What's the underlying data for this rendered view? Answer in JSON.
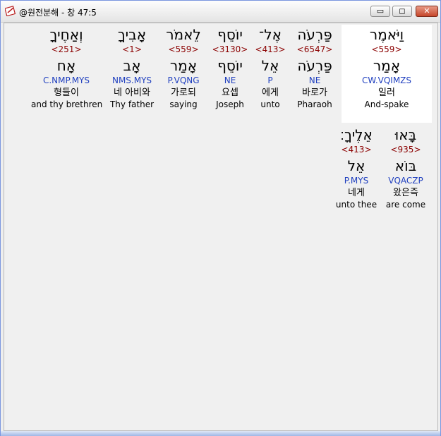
{
  "window": {
    "title": "@원전분해 - 창 47:5",
    "min_glyph": "▭",
    "max_glyph": "◻",
    "close_glyph": "✕"
  },
  "words": [
    {
      "hebrew": "וַיֹּאמֶר",
      "strong": "<559>",
      "lemma": "אָמַר",
      "morph": "CW.VQIMZS",
      "korean": "일러",
      "english": "And-spake",
      "highlighted": true
    },
    {
      "hebrew": "פַּרְעֹה",
      "strong": "<6547>",
      "lemma": "פַּרְעֹה",
      "morph": "NE",
      "korean": "바로가",
      "english": "Pharaoh",
      "highlighted": false
    },
    {
      "hebrew": "אֶל־",
      "strong": "<413>",
      "lemma": "אֵל",
      "morph": "P",
      "korean": "에게",
      "english": "unto",
      "highlighted": false
    },
    {
      "hebrew": "יוֹסֵף",
      "strong": "<3130>",
      "lemma": "יוֹסֵף",
      "morph": "NE",
      "korean": "요셉",
      "english": "Joseph",
      "highlighted": false
    },
    {
      "hebrew": "לֵאמֹר",
      "strong": "<559>",
      "lemma": "אָמַר",
      "morph": "P.VQNG",
      "korean": "가로되",
      "english": "saying",
      "highlighted": false
    },
    {
      "hebrew": "אָבִיךָ",
      "strong": "<1>",
      "lemma": "אָב",
      "morph": "NMS.MYS",
      "korean": "네 아비와",
      "english": "Thy father",
      "highlighted": false
    },
    {
      "hebrew": "וְאַחֶיךָ",
      "strong": "<251>",
      "lemma": "אָח",
      "morph": "C.NMP.MYS",
      "korean": "형들이",
      "english": "and thy brethren",
      "highlighted": false
    },
    {
      "hebrew": "בָּאוּ",
      "strong": "<935>",
      "lemma": "בּוֹא",
      "morph": "VQACZP",
      "korean": "왔은즉",
      "english": "are come",
      "highlighted": false
    },
    {
      "hebrew": "אֵלֶיךָ׃",
      "strong": "<413>",
      "lemma": "אֵל",
      "morph": "P.MYS",
      "korean": "네게",
      "english": "unto thee",
      "highlighted": false
    }
  ]
}
